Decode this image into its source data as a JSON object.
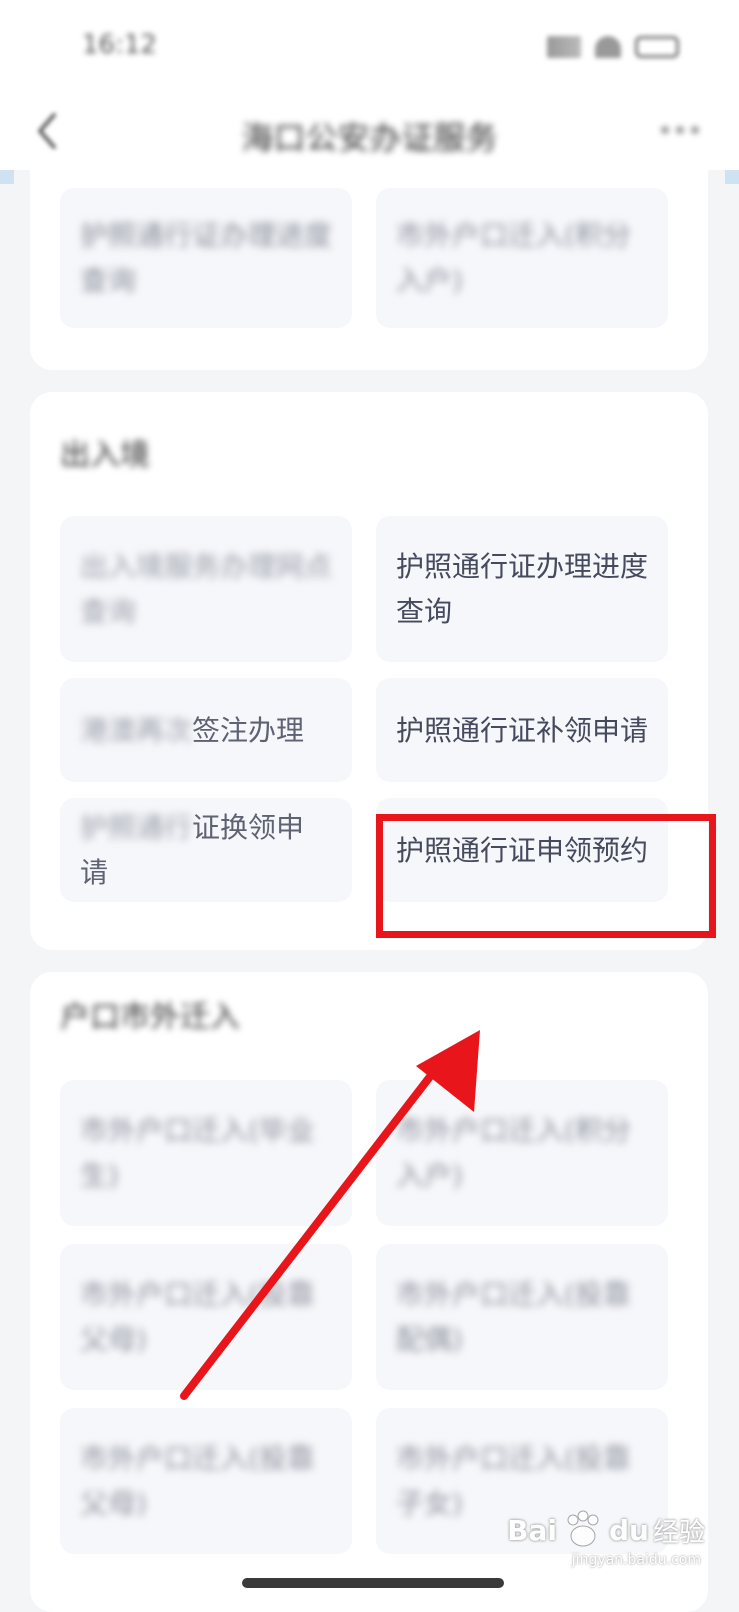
{
  "status_bar": {
    "time": "16:12"
  },
  "nav": {
    "title": "海口公安办证服务"
  },
  "top_card": {
    "tiles": [
      "护照通行证办理进度查询",
      "市外户口迁入(积分入户)"
    ]
  },
  "exit_entry": {
    "title": "出入境",
    "tiles": [
      {
        "blurred": "出入境服务办理网点查询",
        "clear": ""
      },
      {
        "blurred": "",
        "clear": "护照通行证办理进度查询"
      },
      {
        "blurred": "港澳再次",
        "clear": "签注办理"
      },
      {
        "blurred": "",
        "clear": "护照通行证补领申请"
      },
      {
        "blurred": "护照通行",
        "clear": "证换领申请"
      },
      {
        "blurred": "",
        "clear": "护照通行证申领预约"
      }
    ]
  },
  "hukou": {
    "title": "户口市外迁入",
    "tiles": [
      "市外户口迁入(毕业生)",
      "市外户口迁入(积分入户)",
      "市外户口迁入(投靠父母)",
      "市外户口迁入(投靠配偶)",
      "市外户口迁入(投靠父母)",
      "市外户口迁入(投靠子女)"
    ]
  },
  "annotation": {
    "highlight_color": "#e8151b"
  },
  "watermark": {
    "brand": "Bai",
    "brand2": "du",
    "suffix": "经验",
    "url": "jingyan.baidu.com"
  }
}
